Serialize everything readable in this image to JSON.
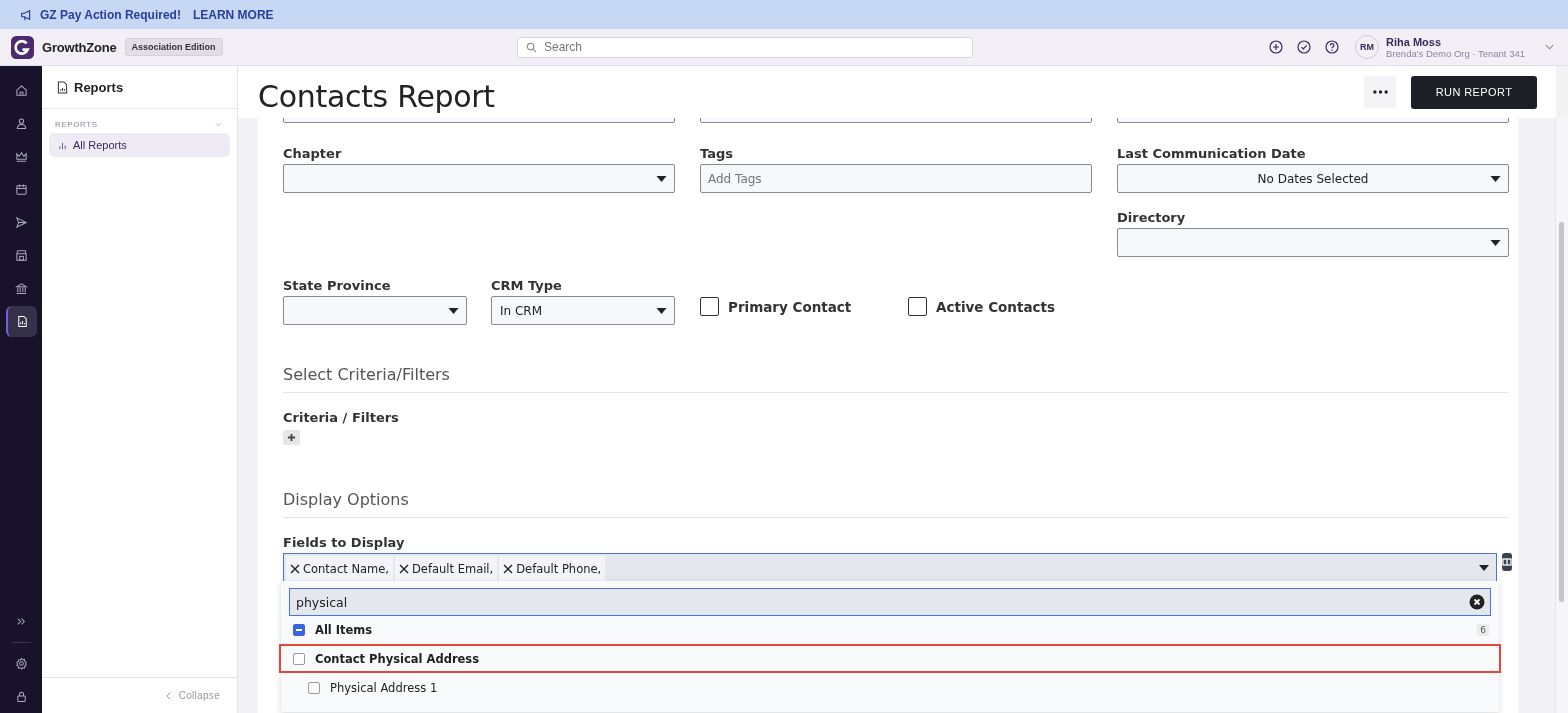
{
  "banner": {
    "message": "GZ Pay Action Required!",
    "link": "LEARN MORE"
  },
  "app": {
    "name": "GrowthZone",
    "edition": "Association Edition"
  },
  "search": {
    "placeholder": "Search"
  },
  "user": {
    "initials": "RM",
    "name": "Riha Moss",
    "org": "Brenda's Demo Org · Tenant 341"
  },
  "rail": [
    {
      "kind": "home",
      "selected": false
    },
    {
      "kind": "person",
      "selected": false
    },
    {
      "kind": "crown",
      "selected": false
    },
    {
      "kind": "calendar",
      "selected": false
    },
    {
      "kind": "send",
      "selected": false
    },
    {
      "kind": "store",
      "selected": false
    },
    {
      "kind": "bank",
      "selected": false
    },
    {
      "kind": "report",
      "selected": true
    }
  ],
  "sidebar": {
    "title": "Reports",
    "section": "REPORTS",
    "items": [
      {
        "label": "All Reports",
        "selected": true
      }
    ],
    "collapse": "Collapse"
  },
  "page": {
    "title": "Contacts Report",
    "run_button": "RUN REPORT"
  },
  "filters": [
    {
      "label": "Chapter",
      "kind": "select"
    },
    {
      "label": "Tags",
      "kind": "tags",
      "placeholder": "Add Tags"
    },
    {
      "label": "Last Communication Date",
      "kind": "date",
      "value": "No Dates Selected"
    },
    {
      "label": "Directory",
      "kind": "select"
    }
  ],
  "filters_row": [
    {
      "label": "State Province",
      "kind": "select"
    },
    {
      "label": "CRM Type",
      "kind": "select",
      "value": "In CRM"
    },
    {
      "label": "Primary Contact",
      "kind": "checkbox",
      "checked": false
    },
    {
      "label": "Active Contacts",
      "kind": "checkbox",
      "checked": false
    }
  ],
  "criteria": {
    "heading": "Select Criteria/Filters",
    "label": "Criteria / Filters"
  },
  "display": {
    "heading": "Display Options",
    "label": "Fields to Display",
    "chips": [
      "Contact Name,",
      "Default Email,",
      "Default Phone,"
    ],
    "search_value": "physical",
    "options": [
      {
        "kind": "all",
        "label": "All Items",
        "indeterminate": true,
        "count": "6"
      },
      {
        "kind": "group",
        "label": "Contact Physical Address",
        "checked": false,
        "highlighted": true
      },
      {
        "kind": "item",
        "label": "Physical Address 1",
        "checked": false,
        "highlighted": false
      }
    ]
  }
}
